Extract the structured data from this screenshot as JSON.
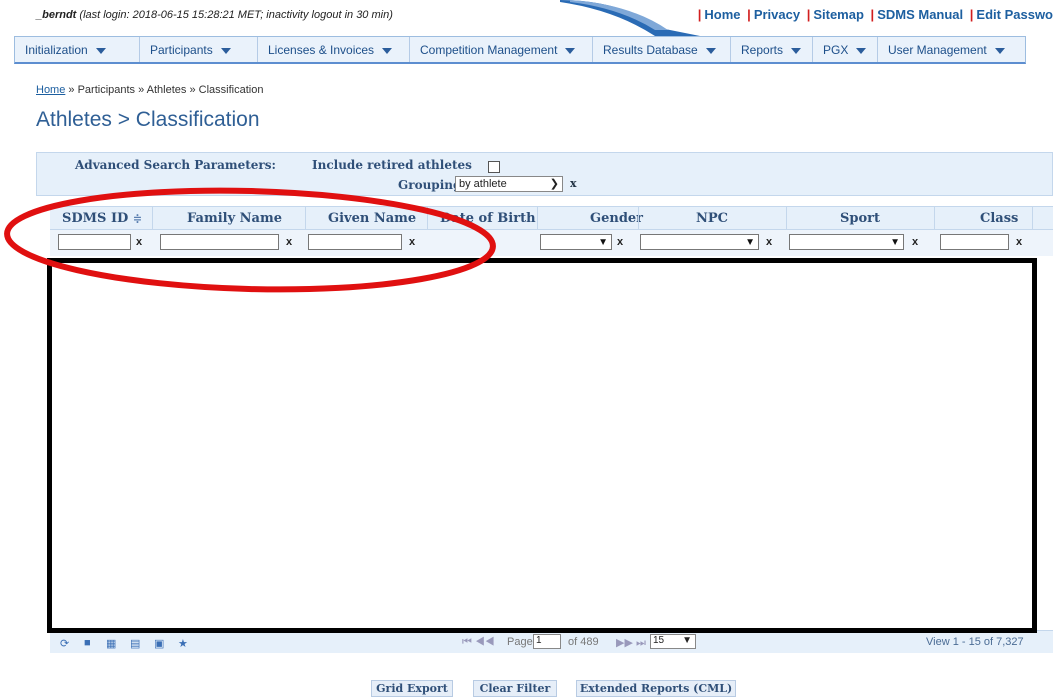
{
  "user": {
    "name": "_berndt",
    "login_info": "(last login: 2018-06-15 15:28:21 MET; inactivity logout in 30 min)"
  },
  "toplinks": [
    "Home",
    "Privacy",
    "Sitemap",
    "SDMS Manual",
    "Edit Passwo"
  ],
  "menu": [
    {
      "label": "Initialization"
    },
    {
      "label": "Participants"
    },
    {
      "label": "Licenses & Invoices"
    },
    {
      "label": "Competition Management"
    },
    {
      "label": "Results Database"
    },
    {
      "label": "Reports"
    },
    {
      "label": "PGX"
    },
    {
      "label": "User Management"
    }
  ],
  "breadcrumb": {
    "home": "Home",
    "rest": " » Participants » Athletes » Classification"
  },
  "page_title": "Athletes > Classification",
  "search": {
    "advanced_label": "Advanced Search Parameters:",
    "retired_label": "Include retired athletes",
    "grouping_label": "Grouping",
    "grouping_value": "by athlete",
    "clear": "x"
  },
  "grid": {
    "columns": {
      "sdms_id": "SDMS ID",
      "family": "Family Name",
      "given": "Given Name",
      "dob": "Date of Birth",
      "gender": "Gender",
      "npc": "NPC",
      "sport": "Sport",
      "class": "Class"
    },
    "sort_icon": "≑",
    "clear": "x"
  },
  "pager": {
    "page_label": "Page",
    "page_value": "1",
    "of_label": "of 489",
    "rows_value": "15",
    "view": "View 1 - 15 of 7,327"
  },
  "buttons": {
    "grid_export": "Grid Export",
    "clear_filter": "Clear Filter",
    "extended": "Extended Reports (CML)"
  },
  "colors": {
    "accent": "#2f5f95",
    "link": "#1d5fa0",
    "annotation": "#e01010"
  }
}
